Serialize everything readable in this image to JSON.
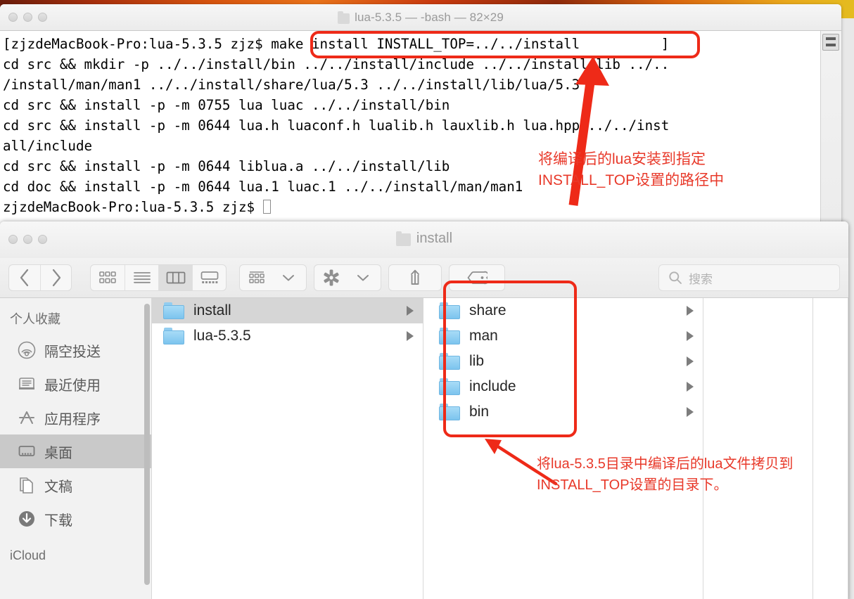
{
  "terminal": {
    "title": "lua-5.3.5 — -bash — 82×29",
    "title_icon": "folder-icon",
    "lines": "[zjzdeMacBook-Pro:lua-5.3.5 zjz$ make install INSTALL_TOP=../../install          ]\ncd src && mkdir -p ../../install/bin ../../install/include ../../install/lib ../..\n/install/man/man1 ../../install/share/lua/5.3 ../../install/lib/lua/5.3\ncd src && install -p -m 0755 lua luac ../../install/bin\ncd src && install -p -m 0644 lua.h luaconf.h lualib.h lauxlib.h lua.hpp ../../inst\nall/include\ncd src && install -p -m 0644 liblua.a ../../install/lib\ncd doc && install -p -m 0644 lua.1 luac.1 ../../install/man/man1",
    "prompt_last": "zjzdeMacBook-Pro:lua-5.3.5 zjz$ ",
    "highlighted_command": "make install INSTALL_TOP=../../install"
  },
  "annotations": {
    "accent_color": "#ee2a18",
    "terminal_note": "将编译后的lua安装到指定INSTALL_TOP设置的路径中",
    "finder_note": "将lua-5.3.5目录中编译后的lua文件拷贝到INSTALL_TOP设置的目录下。"
  },
  "finder": {
    "title": "install",
    "title_icon": "folder-icon",
    "toolbar": {
      "back_label": "‹",
      "forward_label": "›",
      "view_modes": [
        {
          "name": "icon-view",
          "label": "icon"
        },
        {
          "name": "list-view",
          "label": "list"
        },
        {
          "name": "column-view",
          "label": "column",
          "active": true
        },
        {
          "name": "gallery-view",
          "label": "gallery"
        }
      ],
      "arrange_label": "arrange",
      "action_label": "action",
      "share_label": "share",
      "tags_label": "tags"
    },
    "search": {
      "placeholder": "搜索",
      "value": "",
      "icon": "search-icon"
    },
    "sidebar": {
      "sections": [
        {
          "header": "个人收藏",
          "items": [
            {
              "label": "隔空投送",
              "icon": "airdrop-icon",
              "selected": false
            },
            {
              "label": "最近使用",
              "icon": "recents-icon",
              "selected": false
            },
            {
              "label": "应用程序",
              "icon": "applications-icon",
              "selected": false
            },
            {
              "label": "桌面",
              "icon": "desktop-icon",
              "selected": true
            },
            {
              "label": "文稿",
              "icon": "documents-icon",
              "selected": false
            },
            {
              "label": "下载",
              "icon": "downloads-icon",
              "selected": false
            }
          ]
        },
        {
          "header": "iCloud",
          "items": []
        }
      ]
    },
    "columns": [
      {
        "name": "column-1",
        "rows": [
          {
            "label": "install",
            "selected": true,
            "has_children": true
          },
          {
            "label": "lua-5.3.5",
            "selected": false,
            "has_children": true
          }
        ]
      },
      {
        "name": "column-2",
        "rows": [
          {
            "label": "share",
            "selected": false,
            "has_children": true
          },
          {
            "label": "man",
            "selected": false,
            "has_children": true
          },
          {
            "label": "lib",
            "selected": false,
            "has_children": true
          },
          {
            "label": "include",
            "selected": false,
            "has_children": true
          },
          {
            "label": "bin",
            "selected": false,
            "has_children": true
          }
        ]
      },
      {
        "name": "column-3",
        "rows": []
      },
      {
        "name": "column-4",
        "rows": []
      }
    ]
  }
}
